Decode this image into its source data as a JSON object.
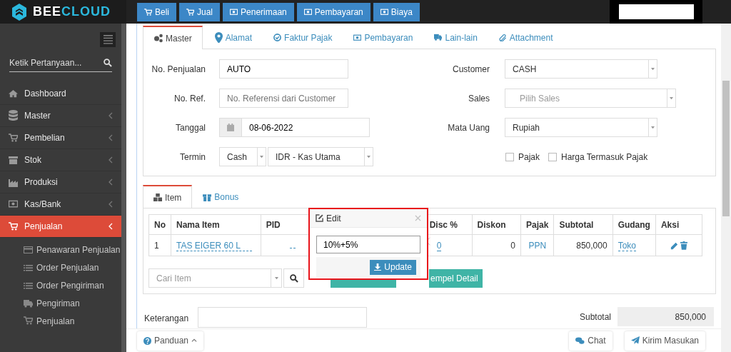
{
  "logo": {
    "parts": [
      "BEE",
      "CLOUD"
    ]
  },
  "top_nav": [
    {
      "label": "Beli"
    },
    {
      "label": "Jual"
    },
    {
      "label": "Penerimaan"
    },
    {
      "label": "Pembayaran"
    },
    {
      "label": "Biaya"
    }
  ],
  "sidebar": {
    "search": {
      "placeholder": "Ketik Pertanyaan..."
    },
    "items": [
      {
        "label": "Dashboard",
        "collapsible": false,
        "selected": false
      },
      {
        "label": "Master",
        "collapsible": true,
        "selected": false
      },
      {
        "label": "Pembelian",
        "collapsible": true,
        "selected": false
      },
      {
        "label": "Stok",
        "collapsible": true,
        "selected": false
      },
      {
        "label": "Produksi",
        "collapsible": true,
        "selected": false
      },
      {
        "label": "Kas/Bank",
        "collapsible": true,
        "selected": false
      },
      {
        "label": "Penjualan",
        "collapsible": true,
        "selected": true,
        "expanded": true,
        "children": [
          {
            "label": "Penawaran Penjualan"
          },
          {
            "label": "Order Penjualan"
          },
          {
            "label": "Order Pengiriman"
          },
          {
            "label": "Pengiriman"
          },
          {
            "label": "Penjualan"
          }
        ]
      }
    ]
  },
  "tabs": [
    {
      "label": "Master",
      "selected": true
    },
    {
      "label": "Alamat",
      "selected": false
    },
    {
      "label": "Faktur Pajak",
      "selected": false
    },
    {
      "label": "Pembayaran",
      "selected": false
    },
    {
      "label": "Lain-lain",
      "selected": false
    },
    {
      "label": "Attachment",
      "selected": false
    }
  ],
  "form_left": [
    {
      "label": "No. Penjualan",
      "kind": "text",
      "value": "AUTO"
    },
    {
      "label": "No. Ref.",
      "kind": "text",
      "placeholder": "No. Referensi dari Customer"
    },
    {
      "label": "Tanggal",
      "kind": "date",
      "value": "08-06-2022"
    },
    {
      "label": "Termin",
      "kind": "selects",
      "values": [
        "Cash",
        "IDR - Kas Utama"
      ]
    }
  ],
  "form_right": [
    {
      "label": "Customer",
      "kind": "select",
      "value": "CASH"
    },
    {
      "label": "Sales",
      "kind": "select",
      "placeholder": "Pilih Sales"
    },
    {
      "label": "Mata Uang",
      "kind": "select",
      "value": "Rupiah"
    },
    {
      "kind": "checkboxes",
      "options": [
        {
          "label": "Pajak",
          "checked": false
        },
        {
          "label": "Harga Termasuk Pajak",
          "checked": false
        }
      ]
    }
  ],
  "item_tabs": [
    {
      "label": "Item",
      "selected": true
    },
    {
      "label": "Bonus",
      "selected": false
    }
  ],
  "table": {
    "columns": [
      "No",
      "Nama Item",
      "PID",
      "Disc %",
      "Diskon",
      "Pajak",
      "Subtotal",
      "Gudang",
      "Aksi"
    ],
    "rows": [
      {
        "cells": [
          "1",
          "TAS EIGER 60 L",
          "",
          "0",
          "0",
          "PPN",
          "850,000",
          "Toko",
          ""
        ]
      }
    ]
  },
  "item_search": {
    "placeholder": "Cari Item"
  },
  "detail_button": {
    "label": "empel Detail"
  },
  "popover": {
    "title": "Edit",
    "value": "10%+5%",
    "button": "Update"
  },
  "keterangan": {
    "label": "Keterangan"
  },
  "subtotal": {
    "label": "Subtotal",
    "value": "850,000"
  },
  "footer": {
    "help": "Panduan",
    "chat": "Chat",
    "feedback": "Kirim Masukan"
  }
}
